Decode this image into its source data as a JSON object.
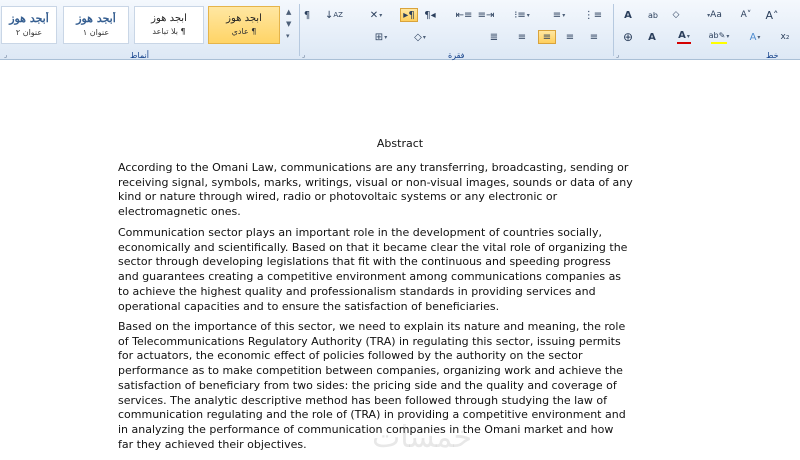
{
  "ribbon": {
    "styles": [
      {
        "name": "أبجد هوز",
        "label": "¶ عادي",
        "selected": true
      },
      {
        "name": "أبجد هوز",
        "label": "¶ بلا تباعد",
        "selected": false
      },
      {
        "name": "أبجد هوز",
        "label": "عنوان ١",
        "selected": false,
        "heading": true
      },
      {
        "name": "أبجد هوز",
        "label": "عنوان ٢",
        "selected": false,
        "heading": true
      }
    ],
    "groups": {
      "styles": "أنماط",
      "paragraph": "فقرة",
      "font": "خط"
    },
    "accent_color": "#ffd466",
    "font_color": "#d40000",
    "highlight_color": "#ffff00"
  },
  "document": {
    "title": "Abstract",
    "paragraphs": [
      [
        "According to the Omani Law, communications are any transferring, broadcasting, sending or",
        "receiving signal, symbols, marks, writings, visual or non-visual images, sounds or data of any",
        "kind or nature through wired, radio or photovoltaic systems or any electronic or",
        "electromagnetic ones."
      ],
      [
        "Communication sector plays an important role in the development of countries socially,",
        "economically and scientifically.  Based on that it  became clear the vital role of organizing the",
        "sector through developing legislations that fit with the continuous and speeding progress",
        "and guarantees creating a competitive environment among communications companies as",
        "to achieve the highest quality and professionalism standards in providing services and",
        "operational capacities  and to ensure the satisfaction of beneficiaries."
      ],
      [
        "Based on the importance of this sector, we need to explain its  nature and meaning, the role",
        "of Telecommunications Regulatory Authority (TRA) in regulating this sector, issuing permits",
        "for actuators, the economic effect of policies followed by the authority on the sector",
        "performance as to make competition between companies, organizing work and achieve the",
        "satisfaction of beneficiary from two sides: the pricing side and the quality and coverage of",
        "services.  The analytic descriptive method has been followed through studying the law of",
        "communication regulating and the role of (TRA) in  providing a  competitive environment and",
        "in analyzing the performance of communication companies in the Omani market and how",
        "far they achieved their objectives."
      ]
    ]
  },
  "watermark": "خمسات"
}
